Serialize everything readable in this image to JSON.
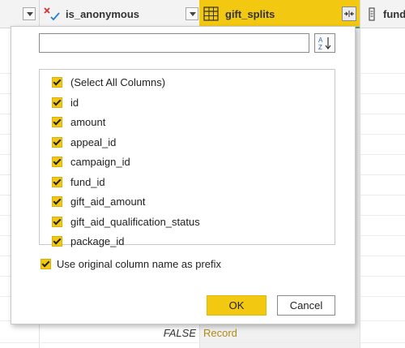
{
  "grid": {
    "columns": [
      {
        "name": "is_anonymous",
        "icon": "true-false-type-icon"
      },
      {
        "name": "gift_splits",
        "icon": "table-type-icon",
        "accent": "#f2c811"
      },
      {
        "name": "fund",
        "icon": "text-type-icon"
      }
    ],
    "visible_row": {
      "is_anonymous": "FALSE",
      "gift_splits": "Record"
    }
  },
  "expand_panel": {
    "search": {
      "value": "",
      "placeholder": ""
    },
    "sort_icon": "sort-az-icon",
    "items": [
      {
        "label": "(Select All Columns)",
        "checked": true
      },
      {
        "label": "id",
        "checked": true
      },
      {
        "label": "amount",
        "checked": true
      },
      {
        "label": "appeal_id",
        "checked": true
      },
      {
        "label": "campaign_id",
        "checked": true
      },
      {
        "label": "fund_id",
        "checked": true
      },
      {
        "label": "gift_aid_amount",
        "checked": true
      },
      {
        "label": "gift_aid_qualification_status",
        "checked": true
      },
      {
        "label": "package_id",
        "checked": true
      }
    ],
    "prefix_option": {
      "label": "Use original column name as prefix",
      "checked": true
    },
    "ok_label": "OK",
    "cancel_label": "Cancel"
  },
  "colors": {
    "accent": "#f2c811",
    "teal": "#34a39c",
    "record_text": "#b08a15"
  }
}
